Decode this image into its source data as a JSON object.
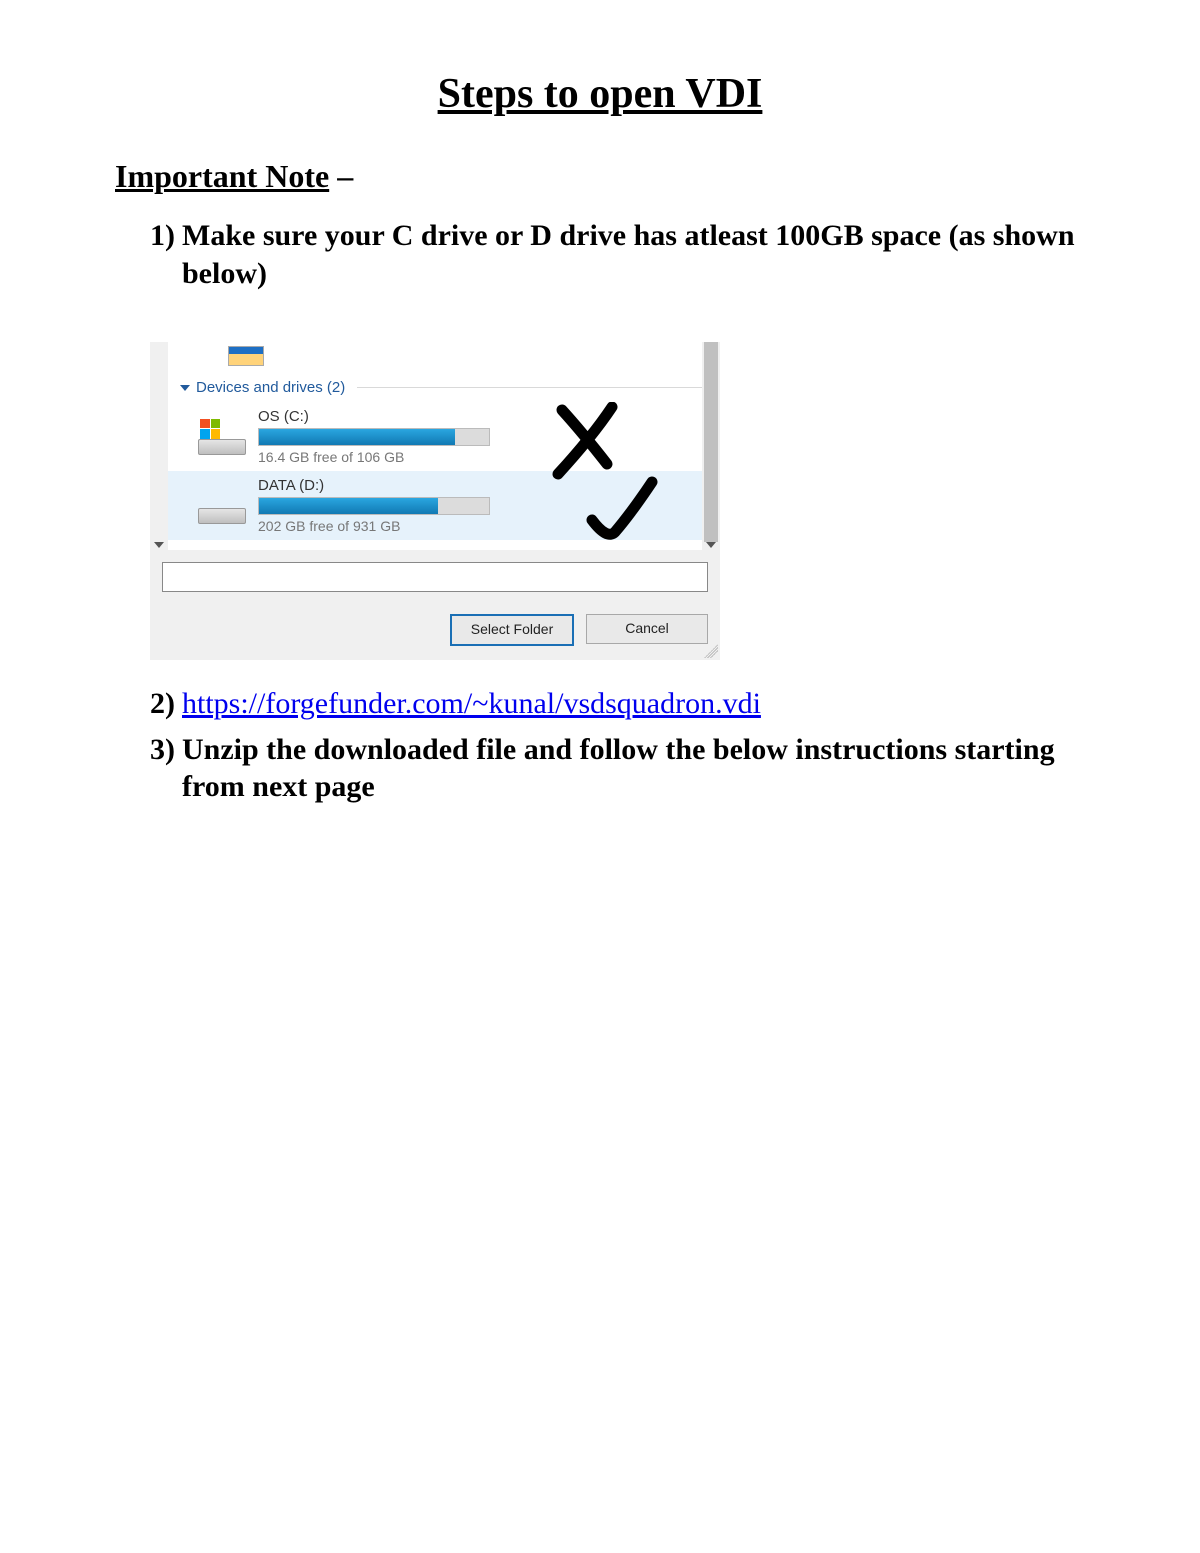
{
  "title": "Steps to open VDI",
  "note_label": "Important Note",
  "note_dash": " –",
  "steps": {
    "s1": {
      "num": "1)",
      "text": "Make sure your C drive or D drive has atleast 100GB space (as shown below)"
    },
    "s2": {
      "num": "2)",
      "link": "https://forgefunder.com/~kunal/vsdsquadron.vdi"
    },
    "s3": {
      "num": "3)",
      "text": "Unzip the downloaded file and follow the below instructions starting from next page"
    }
  },
  "dialog": {
    "group_header": "Devices and drives (2)",
    "drive_c": {
      "name": "OS (C:)",
      "free": "16.4 GB free of 106 GB"
    },
    "drive_d": {
      "name": "DATA (D:)",
      "free": "202 GB free of 931 GB"
    },
    "select_btn": "Select Folder",
    "cancel_btn": "Cancel"
  }
}
